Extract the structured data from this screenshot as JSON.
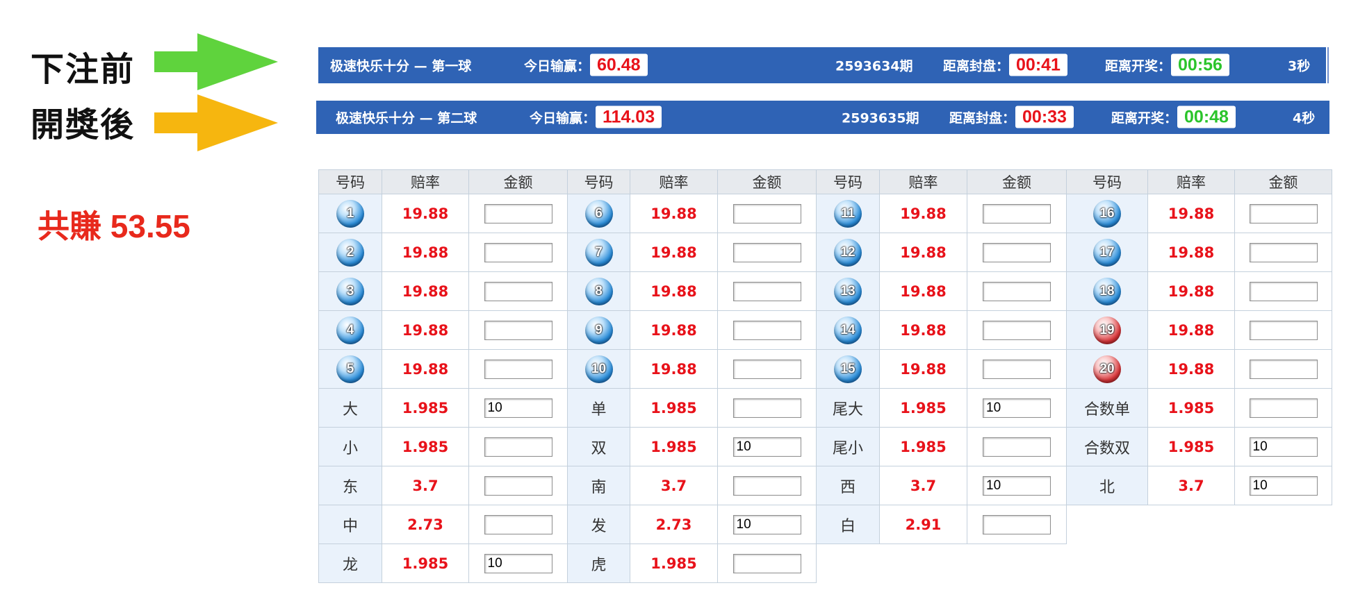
{
  "annotations": {
    "before_label": "下注前",
    "after_label": "開獎後",
    "total_earned": "共賺 53.55",
    "arrow_before_color": "#5fd33d",
    "arrow_after_color": "#f6b60f"
  },
  "bar_before": {
    "title": "极速快乐十分 — 第一球",
    "today_label": "今日输赢：",
    "today_value": "60.48",
    "period": "2593634期",
    "close_label": "距离封盘：",
    "close_time": "00:41",
    "draw_label": "距离开奖：",
    "draw_time": "00:56",
    "countdown": "3秒"
  },
  "bar_after": {
    "title": "极速快乐十分 — 第二球",
    "today_label": "今日输赢：",
    "today_value": "114.03",
    "period": "2593635期",
    "close_label": "距离封盘：",
    "close_time": "00:33",
    "draw_label": "距离开奖：",
    "draw_time": "00:48",
    "countdown": "4秒"
  },
  "table": {
    "headers": [
      "号码",
      "赔率",
      "金额",
      "号码",
      "赔率",
      "金额",
      "号码",
      "赔率",
      "金额",
      "号码",
      "赔率",
      "金额"
    ],
    "rows": [
      [
        {
          "label": "1",
          "ball": "blue",
          "odds": "19.88",
          "amount": ""
        },
        {
          "label": "6",
          "ball": "blue",
          "odds": "19.88",
          "amount": ""
        },
        {
          "label": "11",
          "ball": "blue",
          "odds": "19.88",
          "amount": ""
        },
        {
          "label": "16",
          "ball": "blue",
          "odds": "19.88",
          "amount": ""
        }
      ],
      [
        {
          "label": "2",
          "ball": "blue",
          "odds": "19.88",
          "amount": ""
        },
        {
          "label": "7",
          "ball": "blue",
          "odds": "19.88",
          "amount": ""
        },
        {
          "label": "12",
          "ball": "blue",
          "odds": "19.88",
          "amount": ""
        },
        {
          "label": "17",
          "ball": "blue",
          "odds": "19.88",
          "amount": ""
        }
      ],
      [
        {
          "label": "3",
          "ball": "blue",
          "odds": "19.88",
          "amount": ""
        },
        {
          "label": "8",
          "ball": "blue",
          "odds": "19.88",
          "amount": ""
        },
        {
          "label": "13",
          "ball": "blue",
          "odds": "19.88",
          "amount": ""
        },
        {
          "label": "18",
          "ball": "blue",
          "odds": "19.88",
          "amount": ""
        }
      ],
      [
        {
          "label": "4",
          "ball": "blue",
          "odds": "19.88",
          "amount": ""
        },
        {
          "label": "9",
          "ball": "blue",
          "odds": "19.88",
          "amount": ""
        },
        {
          "label": "14",
          "ball": "blue",
          "odds": "19.88",
          "amount": ""
        },
        {
          "label": "19",
          "ball": "red",
          "odds": "19.88",
          "amount": ""
        }
      ],
      [
        {
          "label": "5",
          "ball": "blue",
          "odds": "19.88",
          "amount": ""
        },
        {
          "label": "10",
          "ball": "blue",
          "odds": "19.88",
          "amount": ""
        },
        {
          "label": "15",
          "ball": "blue",
          "odds": "19.88",
          "amount": ""
        },
        {
          "label": "20",
          "ball": "red",
          "odds": "19.88",
          "amount": ""
        }
      ],
      [
        {
          "label": "大",
          "odds": "1.985",
          "amount": "10"
        },
        {
          "label": "单",
          "odds": "1.985",
          "amount": ""
        },
        {
          "label": "尾大",
          "odds": "1.985",
          "amount": "10"
        },
        {
          "label": "合数单",
          "odds": "1.985",
          "amount": ""
        }
      ],
      [
        {
          "label": "小",
          "odds": "1.985",
          "amount": ""
        },
        {
          "label": "双",
          "odds": "1.985",
          "amount": "10"
        },
        {
          "label": "尾小",
          "odds": "1.985",
          "amount": ""
        },
        {
          "label": "合数双",
          "odds": "1.985",
          "amount": "10"
        }
      ],
      [
        {
          "label": "东",
          "odds": "3.7",
          "amount": ""
        },
        {
          "label": "南",
          "odds": "3.7",
          "amount": ""
        },
        {
          "label": "西",
          "odds": "3.7",
          "amount": "10"
        },
        {
          "label": "北",
          "odds": "3.7",
          "amount": "10"
        }
      ],
      [
        {
          "label": "中",
          "odds": "2.73",
          "amount": ""
        },
        {
          "label": "发",
          "odds": "2.73",
          "amount": "10"
        },
        {
          "label": "白",
          "odds": "2.91",
          "amount": ""
        }
      ],
      [
        {
          "label": "龙",
          "odds": "1.985",
          "amount": "10"
        },
        {
          "label": "虎",
          "odds": "1.985",
          "amount": ""
        }
      ]
    ]
  }
}
